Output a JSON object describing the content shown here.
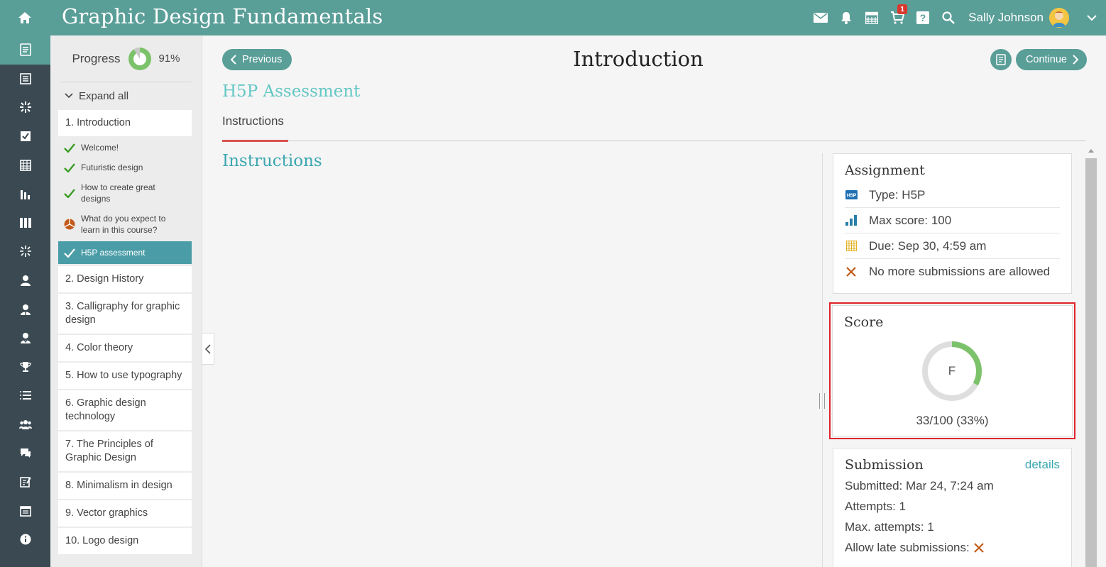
{
  "header": {
    "title": "Graphic Design Fundamentals",
    "cart_badge": "1",
    "user_name": "Sally Johnson"
  },
  "rail_icons": [
    "course-icon",
    "news-icon",
    "activities-icon",
    "tasks-icon",
    "calendar-grid-icon",
    "reports-icon",
    "library-icon",
    "skills-icon",
    "user-icon",
    "instructor-icon",
    "trainee-icon",
    "trophy-icon",
    "list-icon",
    "groups-icon",
    "messages-icon",
    "assessment-icon",
    "schedule-icon",
    "info-icon"
  ],
  "course_nav": {
    "progress_label": "Progress",
    "progress_value": "91%",
    "progress_fraction": 0.91,
    "expand_all": "Expand all",
    "sections": [
      {
        "label": "1. Introduction"
      },
      {
        "label": "2. Design History"
      },
      {
        "label": "3. Calligraphy for graphic design"
      },
      {
        "label": "4. Color theory"
      },
      {
        "label": "5. How to use typography"
      },
      {
        "label": "6. Graphic design technology"
      },
      {
        "label": "7. The Principles of Graphic Design"
      },
      {
        "label": "8. Minimalism in design"
      },
      {
        "label": "9. Vector graphics"
      },
      {
        "label": "10. Logo design"
      }
    ],
    "lessons": [
      {
        "label": "Welcome!",
        "status": "complete"
      },
      {
        "label": "Futuristic design",
        "status": "complete"
      },
      {
        "label": "How to create great designs",
        "status": "complete"
      },
      {
        "label": "What do you expect to learn in this course?",
        "status": "in-progress"
      },
      {
        "label": "H5P assessment",
        "status": "active"
      }
    ]
  },
  "main": {
    "previous_label": "Previous",
    "continue_label": "Continue",
    "page_title": "Introduction",
    "unit_title": "H5P Assessment",
    "tab_label": "Instructions",
    "section_heading": "Instructions"
  },
  "assignment": {
    "title": "Assignment",
    "type": "Type: H5P",
    "max_score": "Max score: 100",
    "due": "Due: Sep 30, 4:59 am",
    "submissions": "No more submissions are allowed"
  },
  "score": {
    "title": "Score",
    "grade": "F",
    "text": "33/100 (33%)",
    "fraction": 0.33
  },
  "submission": {
    "title": "Submission",
    "details_link": "details",
    "submitted": "Submitted: Mar 24, 7:24 am",
    "attempts": "Attempts: 1",
    "max_attempts": "Max. attempts: 1",
    "late": "Allow late submissions:"
  },
  "colors": {
    "header": "#5a9e98",
    "rail": "#3b4a52",
    "active_lesson": "#4a9da7",
    "accent_title": "#64c7c4",
    "check_green": "#3a9d23",
    "score_green": "#7cc26a",
    "highlight_red": "#e0242b"
  }
}
